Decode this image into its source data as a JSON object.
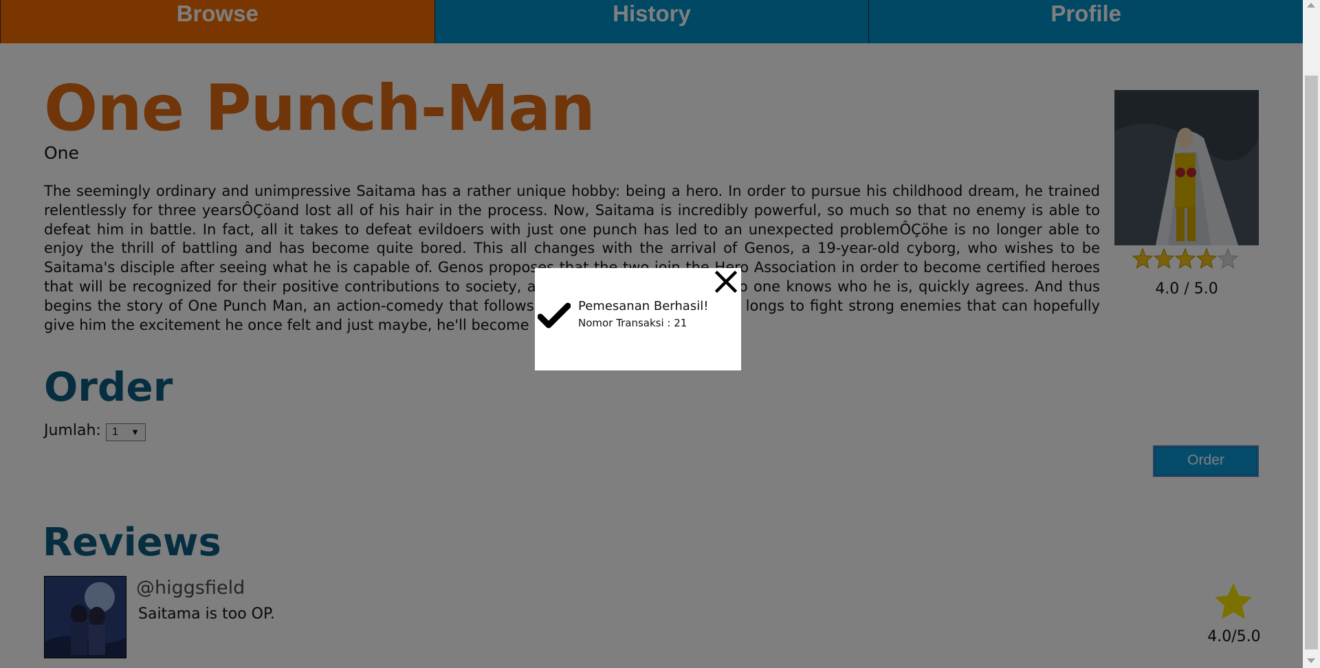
{
  "nav": {
    "tabs": [
      {
        "label": "Browse"
      },
      {
        "label": "History"
      },
      {
        "label": "Profile"
      }
    ],
    "browse_color": "#f26c00",
    "tab_color": "#0090c9"
  },
  "book": {
    "title": "One Punch-Man",
    "author": "One",
    "synopsis": "The seemingly ordinary and unimpressive Saitama has a rather unique hobby: being a hero. In order to pursue his childhood dream, he trained relentlessly for three yearsÔÇöand lost all of his hair in the process. Now, Saitama is incredibly powerful, so much so that no enemy is able to defeat him in battle. In fact, all it takes to defeat evildoers with just one punch has led to an unexpected problemÔÇöhe is no longer able to enjoy the thrill of battling and has become quite bored. This all changes with the arrival of Genos, a 19-year-old cyborg, who wishes to be Saitama's disciple after seeing what he is capable of. Genos proposes that the two join the Hero Association in order to become certified heroes that will be recognized for their positive contributions to society, and Saitama, shocked that no one knows who he is, quickly agrees. And thus begins the story of One Punch Man, an action-comedy that follows an eccentric individual who longs to fight strong enemies that can hopefully give him the excitement he once felt and just maybe, he'll become popular in the process.",
    "cover_icon": "book-cover-image",
    "star_rating": 4,
    "star_max": 5,
    "rating_text": "4.0 / 5.0",
    "title_color": "#e06a12"
  },
  "order": {
    "heading": "Order",
    "qty_label": "Jumlah:",
    "qty_value": "1",
    "button_label": "Order"
  },
  "reviews": {
    "heading": "Reviews",
    "items": [
      {
        "username": "@higgsfield",
        "text": "Saitama is too OP.",
        "score": "4.0/5.0",
        "avatar_icon": "user-avatar-image"
      }
    ]
  },
  "modal": {
    "title": "Pemesanan Berhasil!",
    "subtitle": "Nomor Transaksi : 21",
    "close_icon": "close-icon",
    "check_icon": "checkmark-icon"
  },
  "colors": {
    "heading_blue": "#0d5c80",
    "star_gold": "#f5c518",
    "button_blue": "#0a99d6",
    "overlay": "rgba(0,0,0,0.5)"
  }
}
